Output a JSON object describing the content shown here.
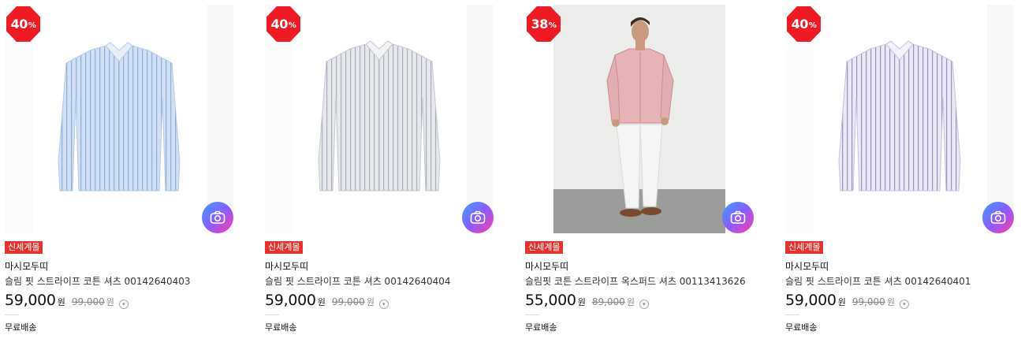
{
  "products": [
    {
      "discount": "40",
      "discount_unit": "%",
      "tag": "신세계몰",
      "brand": "마시모두띠",
      "name": "슬림 핏 스트라이프 코튼 셔츠 00142640403",
      "price": "59,000",
      "price_unit": "원",
      "original_price": "99,000",
      "original_unit": "원",
      "shipping": "무료배송",
      "image": "light-blue-striped-shirt",
      "shirt_color": "#c9d8ef",
      "stripe_color": "#8fb0de"
    },
    {
      "discount": "40",
      "discount_unit": "%",
      "tag": "신세계몰",
      "brand": "마시모두띠",
      "name": "슬림 핏 스트라이프 코튼 셔츠 00142640404",
      "price": "59,000",
      "price_unit": "원",
      "original_price": "99,000",
      "original_unit": "원",
      "shipping": "무료배송",
      "image": "grey-striped-shirt",
      "shirt_color": "#e4e6ea",
      "stripe_color": "#a8aebb"
    },
    {
      "discount": "38",
      "discount_unit": "%",
      "tag": "신세계몰",
      "brand": "마시모두띠",
      "name": "슬림핏 코튼 스트라이프 옥스퍼드 셔츠 00113413626",
      "price": "55,000",
      "price_unit": "원",
      "original_price": "89,000",
      "original_unit": "원",
      "shipping": "무료배송",
      "image": "model-wearing-pink-shirt",
      "shirt_color": "#e6b3b6",
      "stripe_color": "#c98d91"
    },
    {
      "discount": "40",
      "discount_unit": "%",
      "tag": "신세계몰",
      "brand": "마시모두띠",
      "name": "슬림 핏 스트라이프 코튼 셔츠 00142640401",
      "price": "59,000",
      "price_unit": "원",
      "original_price": "99,000",
      "original_unit": "원",
      "shipping": "무료배송",
      "image": "lavender-striped-shirt",
      "shirt_color": "#e2e0ee",
      "stripe_color": "#9d96c4"
    }
  ],
  "icons": {
    "camera": "camera-search-icon",
    "info": "info-chevron-icon"
  },
  "colors": {
    "badge": "#ee1b24",
    "tag": "#e5322d"
  }
}
